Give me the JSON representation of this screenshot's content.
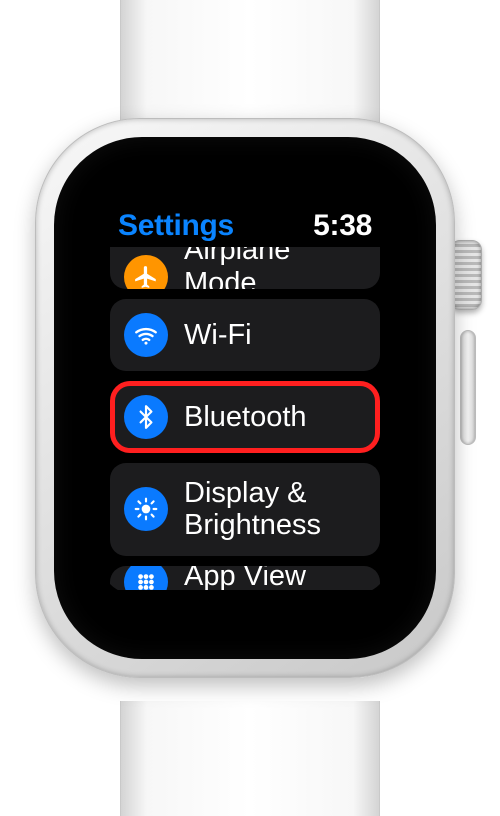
{
  "status": {
    "title": "Settings",
    "time": "5:38"
  },
  "items": [
    {
      "label": "Airplane Mode"
    },
    {
      "label": "Wi-Fi"
    },
    {
      "label": "Bluetooth"
    },
    {
      "label": "Display & Brightness"
    },
    {
      "label": "App View"
    }
  ],
  "highlighted_index": 2
}
